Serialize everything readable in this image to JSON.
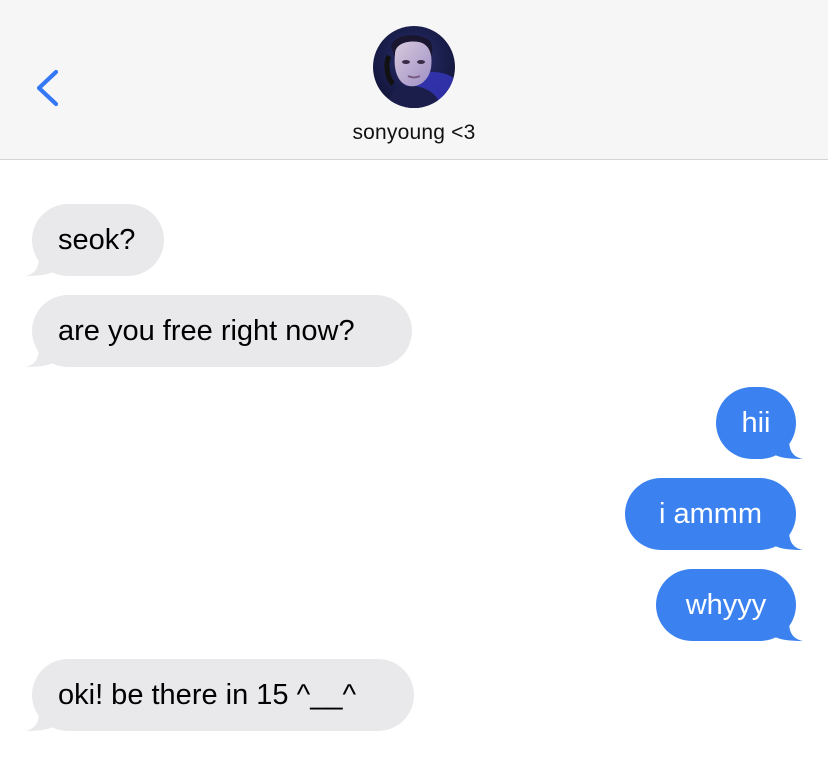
{
  "header": {
    "contact_name": "sonyoung <3"
  },
  "icons": {
    "back": "chevron-left-icon",
    "avatar": "contact-avatar-photo"
  },
  "colors": {
    "accent": "#3b82f0",
    "incoming_bubble": "#e9e9eb",
    "header_bg": "#f6f6f6"
  },
  "messages": [
    {
      "direction": "incoming",
      "text": "seok?"
    },
    {
      "direction": "incoming",
      "text": "are you free right now?"
    },
    {
      "direction": "outgoing",
      "text": "hii"
    },
    {
      "direction": "outgoing",
      "text": "i ammm"
    },
    {
      "direction": "outgoing",
      "text": "whyyy"
    },
    {
      "direction": "incoming",
      "text": "oki! be there in 15 ^__^"
    }
  ]
}
